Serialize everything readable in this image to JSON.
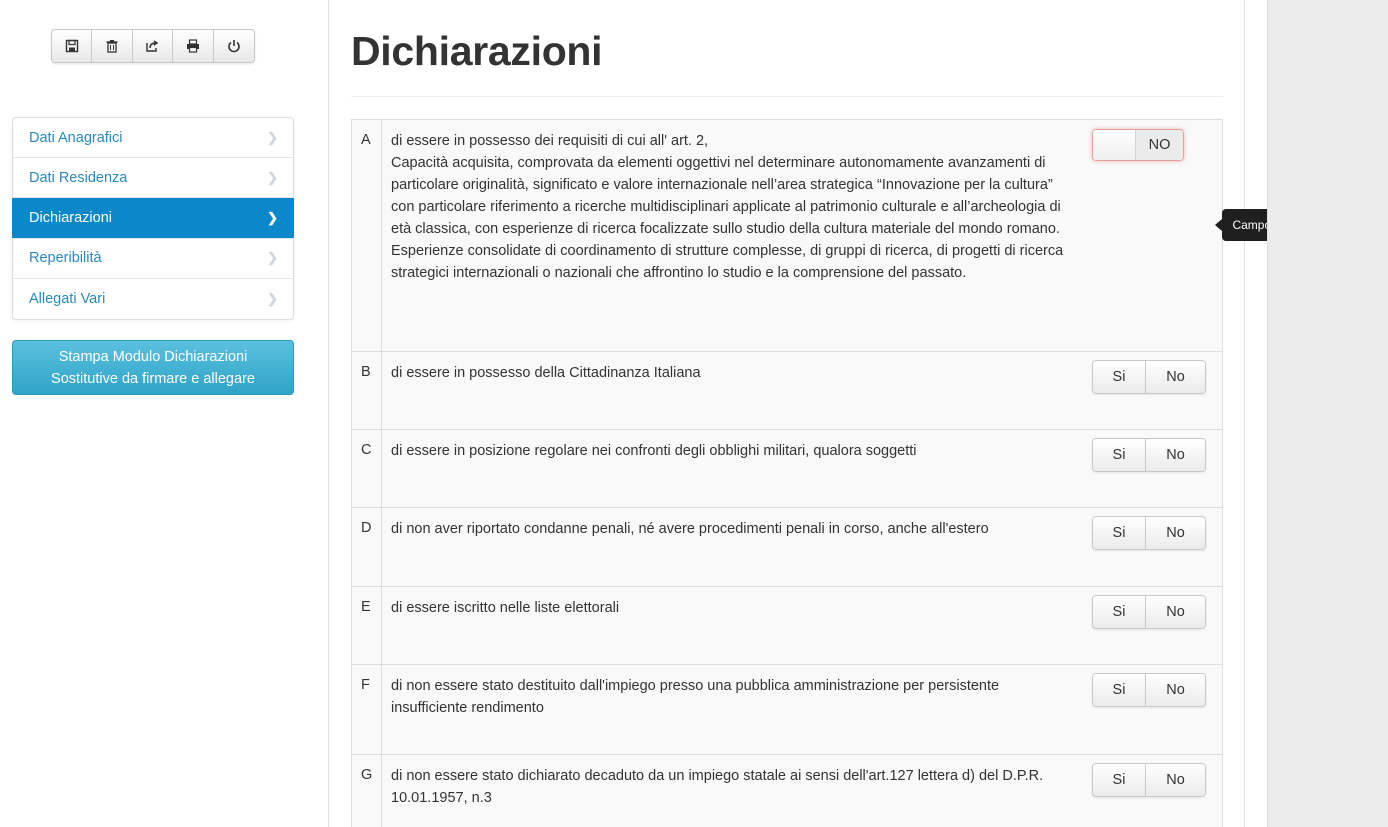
{
  "toolbar": {
    "buttons": [
      {
        "name": "save-button",
        "icon": "floppy-disk-icon"
      },
      {
        "name": "delete-button",
        "icon": "trash-icon"
      },
      {
        "name": "share-button",
        "icon": "share-icon"
      },
      {
        "name": "print-button",
        "icon": "printer-icon"
      },
      {
        "name": "logout-button",
        "icon": "power-icon"
      }
    ]
  },
  "sidebar": {
    "items": [
      {
        "label": "Dati Anagrafici",
        "active": false
      },
      {
        "label": "Dati Residenza",
        "active": false
      },
      {
        "label": "Dichiarazioni",
        "active": true
      },
      {
        "label": "Reperibilità",
        "active": false
      },
      {
        "label": "Allegati Vari",
        "active": false
      }
    ],
    "print_button_line1": "Stampa Modulo Dichiarazioni",
    "print_button_line2": "Sostitutive da firmare e allegare"
  },
  "main": {
    "title": "Dichiarazioni",
    "rows": [
      {
        "letter": "A",
        "line1": "di essere in possesso dei requisiti di cui all' art. 2,",
        "line2": "Capacità acquisita, comprovata da elementi oggettivi nel determinare autonomamente avanzamenti di particolare originalità, significato e valore internazionale nell’area strategica “Innovazione per la cultura” con particolare riferimento a ricerche multidisciplinari applicate al patrimonio culturale e all’archeologia di età classica, con esperienze di ricerca focalizzate sullo studio della cultura materiale del mondo romano. Esperienze consolidate di coordinamento di strutture complesse, di gruppi di ricerca, di progetti di ricerca strategici internazionali o nazionali che affrontino lo studio e la comprensione del passato.",
        "toggle_label": "NO"
      },
      {
        "letter": "B",
        "text": "di essere in possesso della Cittadinanza Italiana",
        "si": "Si",
        "no": "No"
      },
      {
        "letter": "C",
        "text": "di essere in posizione regolare nei confronti degli obblighi militari, qualora soggetti",
        "si": "Si",
        "no": "No"
      },
      {
        "letter": "D",
        "text": "di non aver riportato condanne penali, né avere procedimenti penali in corso, anche all'estero",
        "si": "Si",
        "no": "No"
      },
      {
        "letter": "E",
        "text": "di essere iscritto nelle liste elettorali",
        "si": "Si",
        "no": "No"
      },
      {
        "letter": "F",
        "text": "di non essere stato destituito dall'impiego presso una pubblica amministrazione per persistente insufficiente rendimento",
        "si": "Si",
        "no": "No"
      },
      {
        "letter": "G",
        "text": "di non essere stato dichiarato decaduto da un impiego statale ai sensi dell'art.127 lettera d) del D.P.R. 10.01.1957, n.3",
        "si": "Si",
        "no": "No"
      }
    ]
  },
  "tooltip": {
    "text": "Campo Obbligatorio!"
  },
  "colors": {
    "active_nav": "#0b88c9",
    "link": "#2a88bd",
    "print_button": "#39b3d7",
    "tooltip_bg": "#1f1f1f"
  }
}
